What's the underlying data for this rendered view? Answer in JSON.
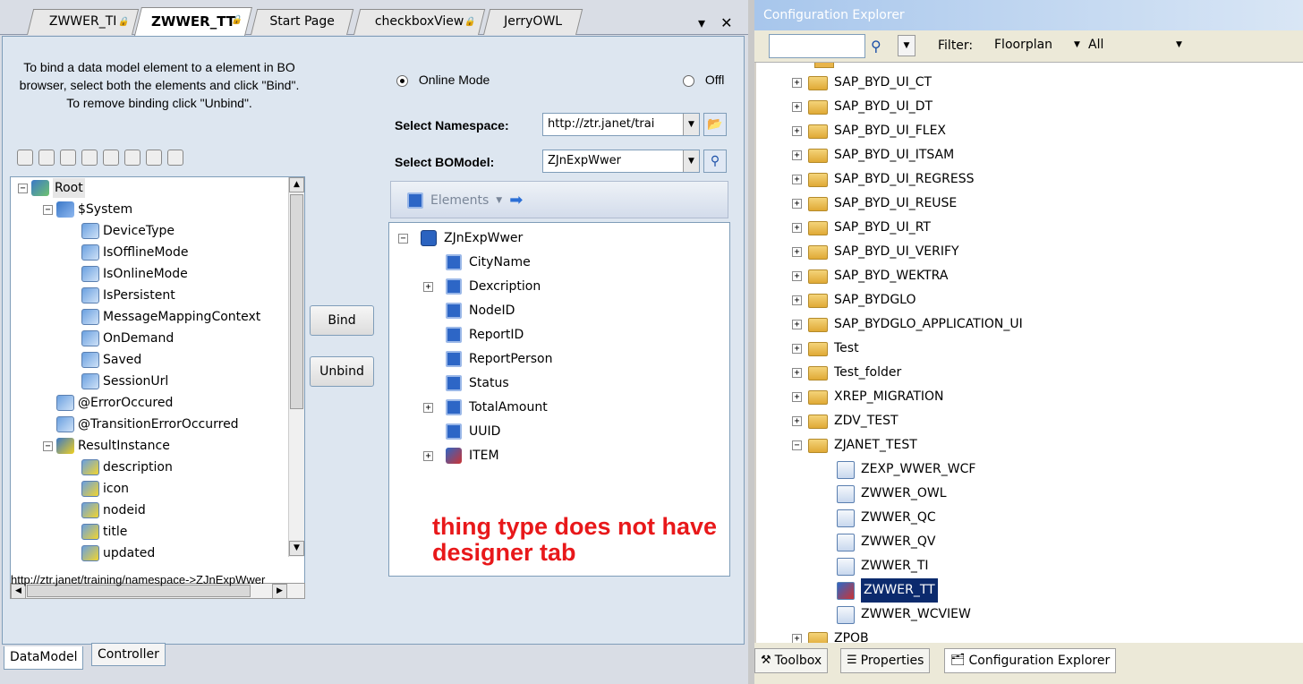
{
  "left_window": {
    "tabs": [
      {
        "label": "ZWWER_TI",
        "locked": true,
        "active": false
      },
      {
        "label": "ZWWER_TT",
        "locked": true,
        "active": true
      },
      {
        "label": "Start Page",
        "locked": false,
        "active": false
      },
      {
        "label": "checkboxView",
        "locked": true,
        "active": false
      },
      {
        "label": "JerryOWL",
        "locked": false,
        "active": false
      }
    ],
    "tab_controls": "▾ ✕",
    "instructions": "To bind a data model element to a element in BO browser, select both the elements and click \"Bind\". To remove binding click \"Unbind\".",
    "data_model_tree": [
      {
        "label": "Root",
        "icon": "root-icon",
        "level": 0,
        "expanded": true,
        "selected": true
      },
      {
        "label": "$System",
        "icon": "system-node-icon",
        "level": 1,
        "expanded": true
      },
      {
        "label": "DeviceType",
        "icon": "element-icon",
        "level": 2
      },
      {
        "label": "IsOfflineMode",
        "icon": "element-icon",
        "level": 2
      },
      {
        "label": "IsOnlineMode",
        "icon": "element-icon",
        "level": 2
      },
      {
        "label": "IsPersistent",
        "icon": "element-icon",
        "level": 2
      },
      {
        "label": "MessageMappingContext",
        "icon": "element-icon",
        "level": 2
      },
      {
        "label": "OnDemand",
        "icon": "element-icon",
        "level": 2
      },
      {
        "label": "Saved",
        "icon": "element-icon",
        "level": 2
      },
      {
        "label": "SessionUrl",
        "icon": "element-icon",
        "level": 2
      },
      {
        "label": "@ErrorOccured",
        "icon": "element-icon",
        "level": 1
      },
      {
        "label": "@TransitionErrorOccurred",
        "icon": "element-icon",
        "level": 1
      },
      {
        "label": "ResultInstance",
        "icon": "result-node-icon",
        "level": 1,
        "expanded": true
      },
      {
        "label": "description",
        "icon": "bound-element-icon",
        "level": 2
      },
      {
        "label": "icon",
        "icon": "bound-element-icon",
        "level": 2
      },
      {
        "label": "nodeid",
        "icon": "bound-element-icon",
        "level": 2
      },
      {
        "label": "title",
        "icon": "bound-element-icon",
        "level": 2
      },
      {
        "label": "updated",
        "icon": "bound-element-icon",
        "level": 2
      }
    ],
    "bind_label": "Bind",
    "unbind_label": "Unbind",
    "online_mode_label": "Online Mode",
    "offline_mode_label": "Offl",
    "select_namespace_label": "Select Namespace:",
    "namespace_value": "http://ztr.janet/trai",
    "select_bomodel_label": "Select BOModel:",
    "bomodel_value": "ZJnExpWwer",
    "elements_label": "Elements",
    "bo_tree": [
      {
        "label": "ZJnExpWwer",
        "icon": "bo-root-icon",
        "level": 0,
        "expander": "-"
      },
      {
        "label": "CityName",
        "icon": "bo-element-icon",
        "level": 1,
        "expander": ""
      },
      {
        "label": "Dexcription",
        "icon": "bo-element-icon",
        "level": 1,
        "expander": "+"
      },
      {
        "label": "NodeID",
        "icon": "bo-element-icon",
        "level": 1,
        "expander": ""
      },
      {
        "label": "ReportID",
        "icon": "bo-element-icon",
        "level": 1,
        "expander": ""
      },
      {
        "label": "ReportPerson",
        "icon": "bo-element-icon",
        "level": 1,
        "expander": ""
      },
      {
        "label": "Status",
        "icon": "bo-element-icon",
        "level": 1,
        "expander": ""
      },
      {
        "label": "TotalAmount",
        "icon": "bo-element-icon",
        "level": 1,
        "expander": "+"
      },
      {
        "label": "UUID",
        "icon": "bo-element-icon",
        "level": 1,
        "expander": ""
      },
      {
        "label": "ITEM",
        "icon": "bo-node-icon",
        "level": 1,
        "expander": "+"
      }
    ],
    "annotation_line1": "thing type does not have",
    "annotation_line2": "designer tab",
    "namespace_path": "http://ztr.janet/training/namespace->ZJnExpWwer",
    "bottom_tabs": [
      {
        "label": "DataModel",
        "active": true
      },
      {
        "label": "Controller",
        "active": false
      }
    ]
  },
  "right_window": {
    "title": "Configuration Explorer",
    "search_value": "",
    "filter_label": "Filter:",
    "filter_value": "Floorplan",
    "filter_scope": "All",
    "tree": [
      {
        "label": "SAP_BYD_UI_CT",
        "kind": "folder",
        "expander": "+"
      },
      {
        "label": "SAP_BYD_UI_DT",
        "kind": "folder",
        "expander": "+"
      },
      {
        "label": "SAP_BYD_UI_FLEX",
        "kind": "folder",
        "expander": "+"
      },
      {
        "label": "SAP_BYD_UI_ITSAM",
        "kind": "folder",
        "expander": "+"
      },
      {
        "label": "SAP_BYD_UI_REGRESS",
        "kind": "folder",
        "expander": "+"
      },
      {
        "label": "SAP_BYD_UI_REUSE",
        "kind": "folder",
        "expander": "+"
      },
      {
        "label": "SAP_BYD_UI_RT",
        "kind": "folder",
        "expander": "+"
      },
      {
        "label": "SAP_BYD_UI_VERIFY",
        "kind": "folder",
        "expander": "+"
      },
      {
        "label": "SAP_BYD_WEKTRA",
        "kind": "folder",
        "expander": "+"
      },
      {
        "label": "SAP_BYDGLO",
        "kind": "folder",
        "expander": "+"
      },
      {
        "label": "SAP_BYDGLO_APPLICATION_UI",
        "kind": "folder",
        "expander": "+"
      },
      {
        "label": "Test",
        "kind": "folder",
        "expander": "+"
      },
      {
        "label": "Test_folder",
        "kind": "folder",
        "expander": "+"
      },
      {
        "label": "XREP_MIGRATION",
        "kind": "folder",
        "expander": "+"
      },
      {
        "label": "ZDV_TEST",
        "kind": "folder",
        "expander": "+"
      },
      {
        "label": "ZJANET_TEST",
        "kind": "folder",
        "expander": "-"
      },
      {
        "label": "ZEXP_WWER_WCF",
        "kind": "file",
        "icon": "floorplan-icon"
      },
      {
        "label": "ZWWER_OWL",
        "kind": "file",
        "icon": "owl-icon"
      },
      {
        "label": "ZWWER_QC",
        "kind": "file",
        "icon": "qc-icon"
      },
      {
        "label": "ZWWER_QV",
        "kind": "file",
        "icon": "qv-icon"
      },
      {
        "label": "ZWWER_TI",
        "kind": "file",
        "icon": "ti-icon"
      },
      {
        "label": "ZWWER_TT",
        "kind": "file",
        "icon": "tt-icon",
        "selected": true
      },
      {
        "label": "ZWWER_WCVIEW",
        "kind": "file",
        "icon": "wcview-icon"
      },
      {
        "label": "ZPOB",
        "kind": "folder",
        "expander": "+"
      }
    ],
    "bottom_tabs": [
      {
        "label": "Toolbox",
        "icon": "toolbox-icon",
        "active": false
      },
      {
        "label": "Properties",
        "icon": "properties-icon",
        "active": false
      },
      {
        "label": "Configuration Explorer",
        "icon": "config-explorer-icon",
        "active": true
      }
    ]
  },
  "colors": {
    "selection": "#0b2a6d",
    "annotation": "#e8181a",
    "pane_background": "#dde6f0"
  }
}
